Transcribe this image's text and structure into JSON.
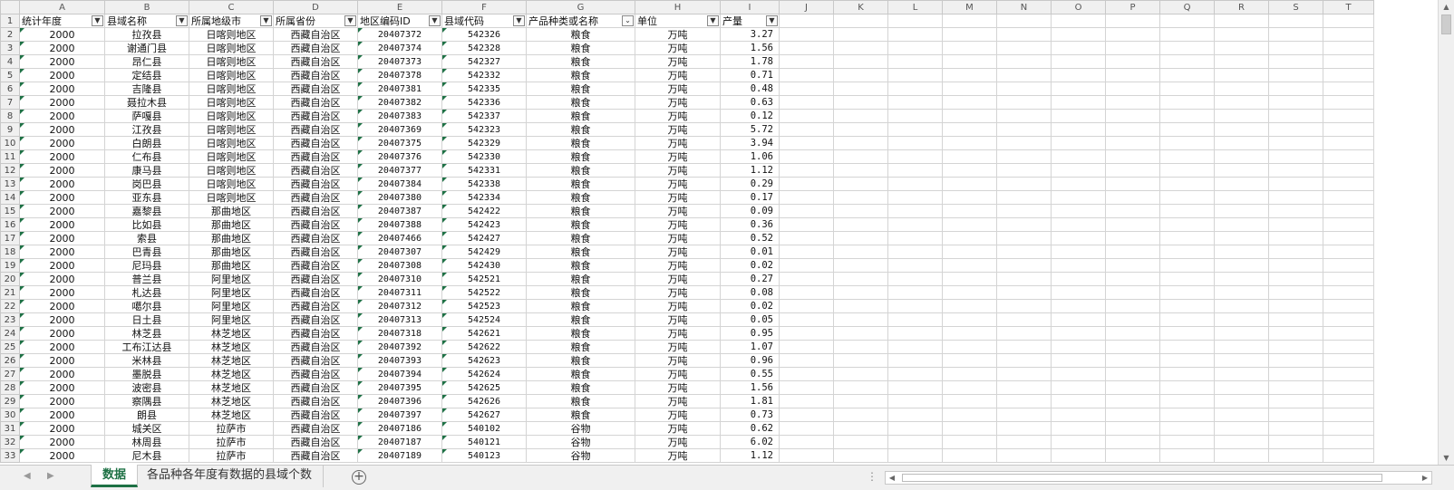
{
  "sheet": {
    "columns": [
      "A",
      "B",
      "C",
      "D",
      "E",
      "F",
      "G",
      "H",
      "I",
      "J",
      "K",
      "L",
      "M",
      "N",
      "O",
      "P",
      "Q",
      "R",
      "S",
      "T"
    ],
    "headers": [
      "统计年度",
      "县域名称",
      "所属地级市",
      "所属省份",
      "地区编码ID",
      "县域代码",
      "产品种类或名称",
      "单位",
      "产量"
    ],
    "filter_icons": [
      "filter-dropdown-icon",
      "filter-dropdown-icon",
      "filter-dropdown-icon",
      "filter-dropdown-icon",
      "filter-dropdown-icon",
      "filter-dropdown-icon",
      "filter-active-icon",
      "filter-dropdown-icon",
      "filter-dropdown-icon"
    ],
    "rows": [
      [
        "2",
        "2000",
        "拉孜县",
        "日喀则地区",
        "西藏自治区",
        "20407372",
        "542326",
        "粮食",
        "万吨",
        "3.27"
      ],
      [
        "3",
        "2000",
        "谢通门县",
        "日喀则地区",
        "西藏自治区",
        "20407374",
        "542328",
        "粮食",
        "万吨",
        "1.56"
      ],
      [
        "4",
        "2000",
        "昂仁县",
        "日喀则地区",
        "西藏自治区",
        "20407373",
        "542327",
        "粮食",
        "万吨",
        "1.78"
      ],
      [
        "5",
        "2000",
        "定结县",
        "日喀则地区",
        "西藏自治区",
        "20407378",
        "542332",
        "粮食",
        "万吨",
        "0.71"
      ],
      [
        "6",
        "2000",
        "吉隆县",
        "日喀则地区",
        "西藏自治区",
        "20407381",
        "542335",
        "粮食",
        "万吨",
        "0.48"
      ],
      [
        "7",
        "2000",
        "聂拉木县",
        "日喀则地区",
        "西藏自治区",
        "20407382",
        "542336",
        "粮食",
        "万吨",
        "0.63"
      ],
      [
        "8",
        "2000",
        "萨嘎县",
        "日喀则地区",
        "西藏自治区",
        "20407383",
        "542337",
        "粮食",
        "万吨",
        "0.12"
      ],
      [
        "9",
        "2000",
        "江孜县",
        "日喀则地区",
        "西藏自治区",
        "20407369",
        "542323",
        "粮食",
        "万吨",
        "5.72"
      ],
      [
        "10",
        "2000",
        "白朗县",
        "日喀则地区",
        "西藏自治区",
        "20407375",
        "542329",
        "粮食",
        "万吨",
        "3.94"
      ],
      [
        "11",
        "2000",
        "仁布县",
        "日喀则地区",
        "西藏自治区",
        "20407376",
        "542330",
        "粮食",
        "万吨",
        "1.06"
      ],
      [
        "12",
        "2000",
        "康马县",
        "日喀则地区",
        "西藏自治区",
        "20407377",
        "542331",
        "粮食",
        "万吨",
        "1.12"
      ],
      [
        "13",
        "2000",
        "岗巴县",
        "日喀则地区",
        "西藏自治区",
        "20407384",
        "542338",
        "粮食",
        "万吨",
        "0.29"
      ],
      [
        "14",
        "2000",
        "亚东县",
        "日喀则地区",
        "西藏自治区",
        "20407380",
        "542334",
        "粮食",
        "万吨",
        "0.17"
      ],
      [
        "15",
        "2000",
        "嘉黎县",
        "那曲地区",
        "西藏自治区",
        "20407387",
        "542422",
        "粮食",
        "万吨",
        "0.09"
      ],
      [
        "16",
        "2000",
        "比如县",
        "那曲地区",
        "西藏自治区",
        "20407388",
        "542423",
        "粮食",
        "万吨",
        "0.36"
      ],
      [
        "17",
        "2000",
        "索县",
        "那曲地区",
        "西藏自治区",
        "20407466",
        "542427",
        "粮食",
        "万吨",
        "0.52"
      ],
      [
        "18",
        "2000",
        "巴青县",
        "那曲地区",
        "西藏自治区",
        "20407307",
        "542429",
        "粮食",
        "万吨",
        "0.01"
      ],
      [
        "19",
        "2000",
        "尼玛县",
        "那曲地区",
        "西藏自治区",
        "20407308",
        "542430",
        "粮食",
        "万吨",
        "0.02"
      ],
      [
        "20",
        "2000",
        "普兰县",
        "阿里地区",
        "西藏自治区",
        "20407310",
        "542521",
        "粮食",
        "万吨",
        "0.27"
      ],
      [
        "21",
        "2000",
        "札达县",
        "阿里地区",
        "西藏自治区",
        "20407311",
        "542522",
        "粮食",
        "万吨",
        "0.08"
      ],
      [
        "22",
        "2000",
        "噶尔县",
        "阿里地区",
        "西藏自治区",
        "20407312",
        "542523",
        "粮食",
        "万吨",
        "0.02"
      ],
      [
        "23",
        "2000",
        "日土县",
        "阿里地区",
        "西藏自治区",
        "20407313",
        "542524",
        "粮食",
        "万吨",
        "0.05"
      ],
      [
        "24",
        "2000",
        "林芝县",
        "林芝地区",
        "西藏自治区",
        "20407318",
        "542621",
        "粮食",
        "万吨",
        "0.95"
      ],
      [
        "25",
        "2000",
        "工布江达县",
        "林芝地区",
        "西藏自治区",
        "20407392",
        "542622",
        "粮食",
        "万吨",
        "1.07"
      ],
      [
        "26",
        "2000",
        "米林县",
        "林芝地区",
        "西藏自治区",
        "20407393",
        "542623",
        "粮食",
        "万吨",
        "0.96"
      ],
      [
        "27",
        "2000",
        "墨脱县",
        "林芝地区",
        "西藏自治区",
        "20407394",
        "542624",
        "粮食",
        "万吨",
        "0.55"
      ],
      [
        "28",
        "2000",
        "波密县",
        "林芝地区",
        "西藏自治区",
        "20407395",
        "542625",
        "粮食",
        "万吨",
        "1.56"
      ],
      [
        "29",
        "2000",
        "察隅县",
        "林芝地区",
        "西藏自治区",
        "20407396",
        "542626",
        "粮食",
        "万吨",
        "1.81"
      ],
      [
        "30",
        "2000",
        "朗县",
        "林芝地区",
        "西藏自治区",
        "20407397",
        "542627",
        "粮食",
        "万吨",
        "0.73"
      ],
      [
        "31",
        "2000",
        "城关区",
        "拉萨市",
        "西藏自治区",
        "20407186",
        "540102",
        "谷物",
        "万吨",
        "0.62"
      ],
      [
        "32",
        "2000",
        "林周县",
        "拉萨市",
        "西藏自治区",
        "20407187",
        "540121",
        "谷物",
        "万吨",
        "6.02"
      ],
      [
        "33",
        "2000",
        "尼木县",
        "拉萨市",
        "西藏自治区",
        "20407189",
        "540123",
        "谷物",
        "万吨",
        "1.12"
      ]
    ]
  },
  "tabs": {
    "items": [
      "数据",
      "各品种各年度有数据的县域个数"
    ],
    "active_index": 0,
    "add_icon": "add-sheet-icon"
  },
  "colors": {
    "accent": "#1e7145",
    "header_bg": "#f0f0f0",
    "gridline": "#d4d4d4"
  }
}
